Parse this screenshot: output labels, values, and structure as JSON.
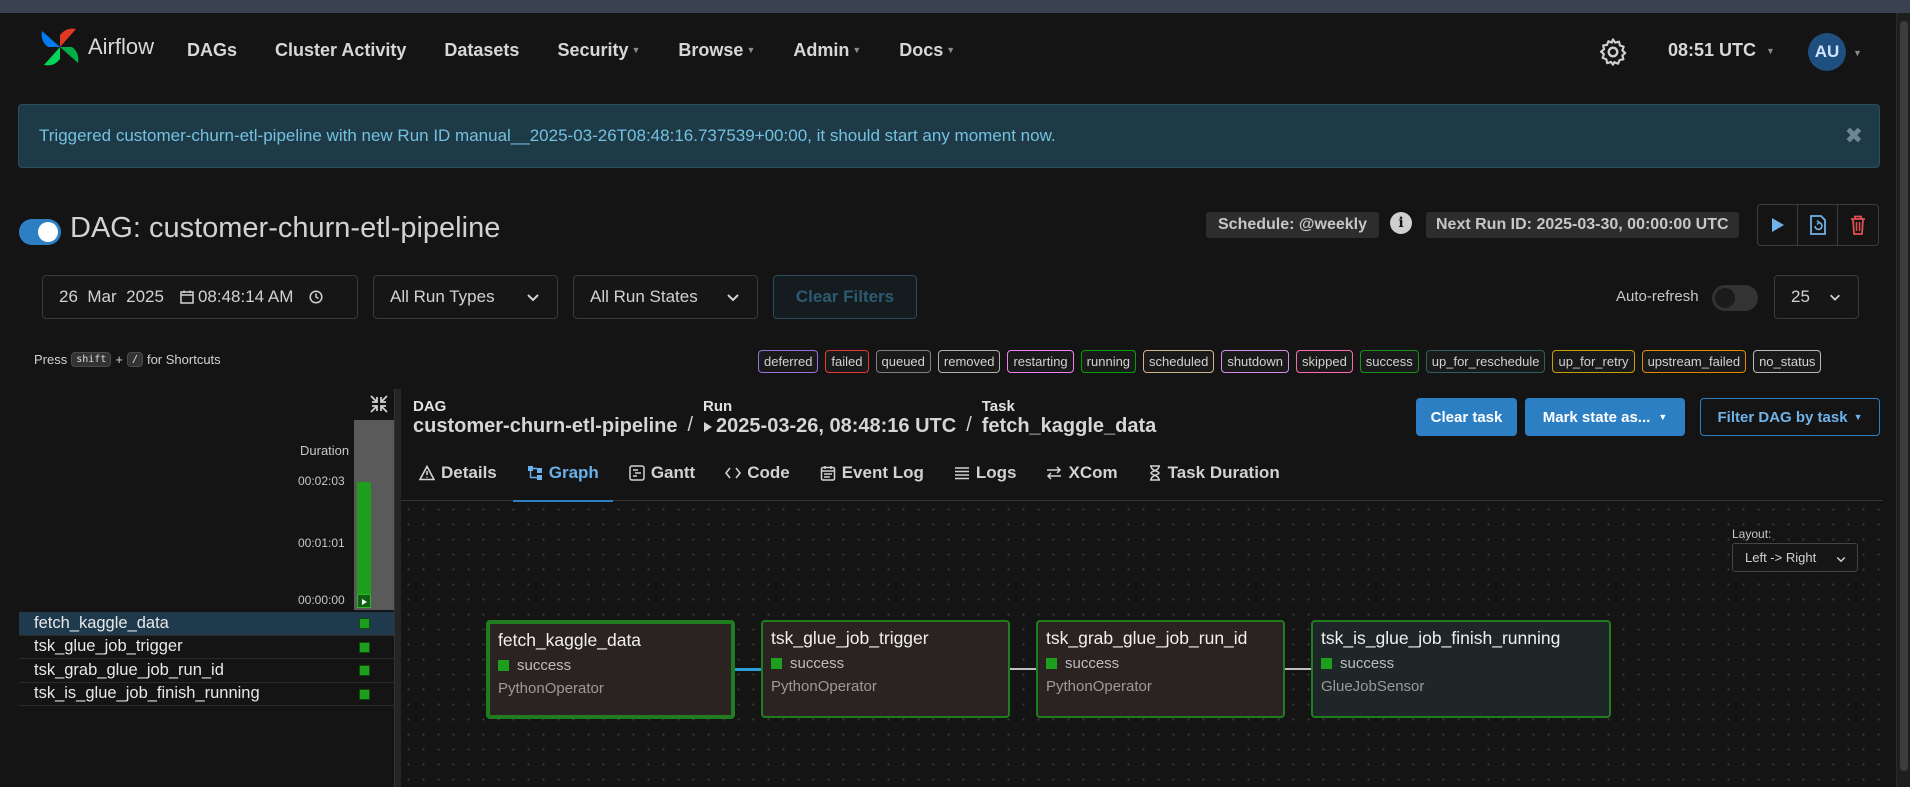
{
  "nav": {
    "brand": "Airflow",
    "menu": [
      {
        "label": "DAGs",
        "dropdown": false
      },
      {
        "label": "Cluster Activity",
        "dropdown": false
      },
      {
        "label": "Datasets",
        "dropdown": false
      },
      {
        "label": "Security",
        "dropdown": true
      },
      {
        "label": "Browse",
        "dropdown": true
      },
      {
        "label": "Admin",
        "dropdown": true
      },
      {
        "label": "Docs",
        "dropdown": true
      }
    ],
    "time": "08:51 UTC",
    "avatar": "AU"
  },
  "alert": {
    "message": "Triggered customer-churn-etl-pipeline with new Run ID manual__2025-03-26T08:48:16.737539+00:00, it should start any moment now."
  },
  "dag": {
    "title": "DAG: customer-churn-etl-pipeline",
    "schedule": "Schedule: @weekly",
    "next_run": "Next Run ID: 2025-03-30, 00:00:00 UTC"
  },
  "filters": {
    "date_day": "26",
    "date_month": "Mar",
    "date_year": "2025",
    "time": "08:48:14 AM",
    "run_types": "All Run Types",
    "run_states": "All Run States",
    "clear_filters": "Clear Filters",
    "auto_refresh": "Auto-refresh",
    "page_size": "25"
  },
  "shortcuts": {
    "press": "Press",
    "key1": "shift",
    "plus": "+",
    "key2": "/",
    "suffix": "for Shortcuts"
  },
  "legend": [
    {
      "label": "deferred",
      "color": "#9370db"
    },
    {
      "label": "failed",
      "color": "#e53935"
    },
    {
      "label": "queued",
      "color": "#808080"
    },
    {
      "label": "removed",
      "color": "#b0b0b0"
    },
    {
      "label": "restarting",
      "color": "#ee82ee"
    },
    {
      "label": "running",
      "color": "#00a000"
    },
    {
      "label": "scheduled",
      "color": "#d2b48c"
    },
    {
      "label": "shutdown",
      "color": "#d58dea"
    },
    {
      "label": "skipped",
      "color": "#ff69b4"
    },
    {
      "label": "success",
      "color": "#1a8f1a"
    },
    {
      "label": "up_for_reschedule",
      "color": "#2f5f5f"
    },
    {
      "label": "up_for_retry",
      "color": "#c8a000"
    },
    {
      "label": "upstream_failed",
      "color": "#e08a00"
    },
    {
      "label": "no_status",
      "color": "#b8b8b8"
    }
  ],
  "grid": {
    "duration_label": "Duration",
    "ticks": [
      "00:02:03",
      "00:01:01",
      "00:00:00"
    ],
    "tasks": [
      {
        "name": "fetch_kaggle_data",
        "selected": true
      },
      {
        "name": "tsk_glue_job_trigger",
        "selected": false
      },
      {
        "name": "tsk_grab_glue_job_run_id",
        "selected": false
      },
      {
        "name": "tsk_is_glue_job_finish_running",
        "selected": false
      }
    ]
  },
  "details": {
    "dag_label": "DAG",
    "dag_value": "customer-churn-etl-pipeline",
    "run_label": "Run",
    "run_value": "2025-03-26, 08:48:16 UTC",
    "task_label": "Task",
    "task_value": "fetch_kaggle_data",
    "sep": "/",
    "clear_task": "Clear task",
    "mark_state": "Mark state as...",
    "filter_dag": "Filter DAG by task"
  },
  "tabs": [
    {
      "label": "Details",
      "icon": "warning-triangle-icon",
      "active": false
    },
    {
      "label": "Graph",
      "icon": "graph-icon",
      "active": true
    },
    {
      "label": "Gantt",
      "icon": "gantt-icon",
      "active": false
    },
    {
      "label": "Code",
      "icon": "code-icon",
      "active": false
    },
    {
      "label": "Event Log",
      "icon": "calendar-icon",
      "active": false
    },
    {
      "label": "Logs",
      "icon": "list-icon",
      "active": false
    },
    {
      "label": "XCom",
      "icon": "arrows-icon",
      "active": false
    },
    {
      "label": "Task Duration",
      "icon": "hourglass-icon",
      "active": false
    }
  ],
  "graph": {
    "layout_label": "Layout:",
    "layout_value": "Left -> Right",
    "nodes": [
      {
        "name": "fetch_kaggle_data",
        "state": "success",
        "operator": "PythonOperator"
      },
      {
        "name": "tsk_glue_job_trigger",
        "state": "success",
        "operator": "PythonOperator"
      },
      {
        "name": "tsk_grab_glue_job_run_id",
        "state": "success",
        "operator": "PythonOperator"
      },
      {
        "name": "tsk_is_glue_job_finish_running",
        "state": "success",
        "operator": "GlueJobSensor"
      }
    ]
  }
}
